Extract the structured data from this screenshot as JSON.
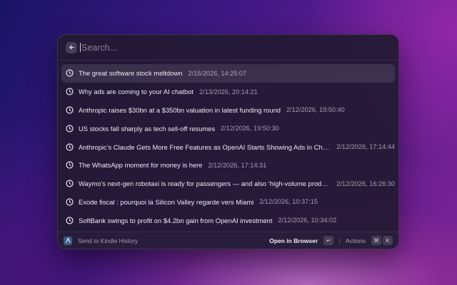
{
  "search": {
    "placeholder": "Search..."
  },
  "items": [
    {
      "title": "The great software stock meltdown",
      "date": "2/15/2026, 14:25:07"
    },
    {
      "title": "Why ads are coming to your AI chatbot",
      "date": "2/13/2026, 20:14:21"
    },
    {
      "title": "Anthropic raises $30bn at a $350bn valuation in latest funding round",
      "date": "2/12/2026, 19:50:40"
    },
    {
      "title": "US stocks fall sharply as tech sell-off resumes",
      "date": "2/12/2026, 19:50:30"
    },
    {
      "title": "Anthropic’s Claude Gets More Free Features as OpenAI Starts Showing Ads in ChatGPT",
      "date": "2/12/2026, 17:14:44"
    },
    {
      "title": "The WhatsApp moment for money is here",
      "date": "2/12/2026, 17:14:31"
    },
    {
      "title": "Waymo’s next-gen robotaxi is ready for passengers — and also ‘high-volume production’",
      "date": "2/12/2026, 16:26:30"
    },
    {
      "title": "Exode fiscal : pourquoi la Silicon Valley regarde vers Miami",
      "date": "2/12/2026, 10:37:15"
    },
    {
      "title": "SoftBank swings to profit on $4.2bn gain from OpenAI investment",
      "date": "2/12/2026, 10:34:02"
    }
  ],
  "selected_index": 0,
  "footer": {
    "extension_name": "Send to Kindle History",
    "primary_action": "Open in Browser",
    "primary_shortcut": "↵",
    "actions_label": "Actions",
    "actions_key_mod": "⌘",
    "actions_key": "K"
  }
}
